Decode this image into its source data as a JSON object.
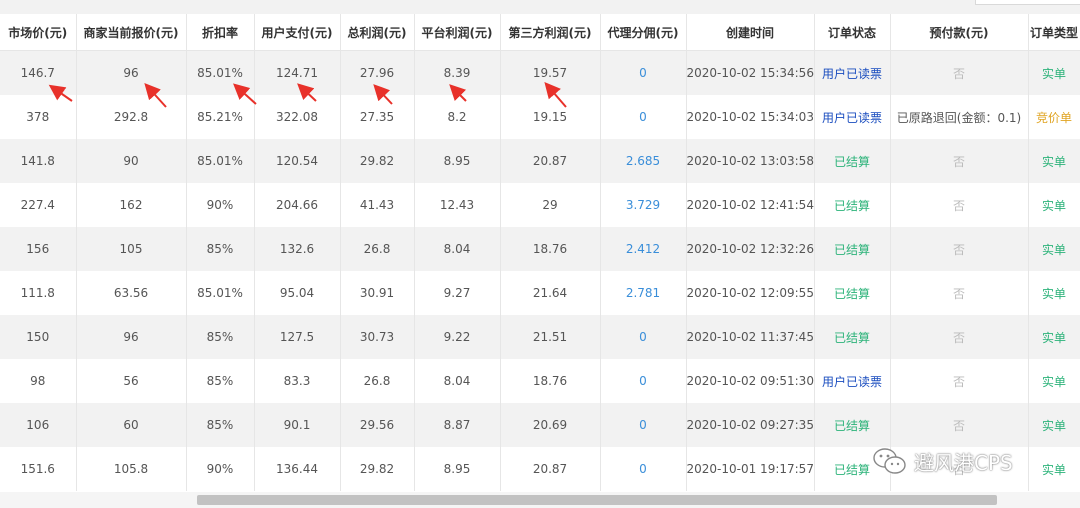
{
  "headers": [
    "市场价(元)",
    "商家当前报价(元)",
    "折扣率",
    "用户支付(元)",
    "总利润(元)",
    "平台利润(元)",
    "第三方利润(元)",
    "代理分佣(元)",
    "创建时间",
    "订单状态",
    "预付款(元)",
    "订单类型"
  ],
  "rows": [
    [
      "146.7",
      "96",
      "85.01%",
      "124.71",
      "27.96",
      "8.39",
      "19.57",
      "0",
      "2020-10-02 15:34:56",
      "用户已读票",
      "否",
      "实单"
    ],
    [
      "378",
      "292.8",
      "85.21%",
      "322.08",
      "27.35",
      "8.2",
      "19.15",
      "0",
      "2020-10-02 15:34:03",
      "用户已读票",
      "已原路退回(金额：0.1)",
      "竞价单"
    ],
    [
      "141.8",
      "90",
      "85.01%",
      "120.54",
      "29.82",
      "8.95",
      "20.87",
      "2.685",
      "2020-10-02 13:03:58",
      "已结算",
      "否",
      "实单"
    ],
    [
      "227.4",
      "162",
      "90%",
      "204.66",
      "41.43",
      "12.43",
      "29",
      "3.729",
      "2020-10-02 12:41:54",
      "已结算",
      "否",
      "实单"
    ],
    [
      "156",
      "105",
      "85%",
      "132.6",
      "26.8",
      "8.04",
      "18.76",
      "2.412",
      "2020-10-02 12:32:26",
      "已结算",
      "否",
      "实单"
    ],
    [
      "111.8",
      "63.56",
      "85.01%",
      "95.04",
      "30.91",
      "9.27",
      "21.64",
      "2.781",
      "2020-10-02 12:09:55",
      "已结算",
      "否",
      "实单"
    ],
    [
      "150",
      "96",
      "85%",
      "127.5",
      "30.73",
      "9.22",
      "21.51",
      "0",
      "2020-10-02 11:37:45",
      "已结算",
      "否",
      "实单"
    ],
    [
      "98",
      "56",
      "85%",
      "83.3",
      "26.8",
      "8.04",
      "18.76",
      "0",
      "2020-10-02 09:51:30",
      "用户已读票",
      "否",
      "实单"
    ],
    [
      "106",
      "60",
      "85%",
      "90.1",
      "29.56",
      "8.87",
      "20.69",
      "0",
      "2020-10-02 09:27:35",
      "已结算",
      "否",
      "实单"
    ],
    [
      "151.6",
      "105.8",
      "90%",
      "136.44",
      "29.82",
      "8.95",
      "20.87",
      "0",
      "2020-10-01 19:17:57",
      "已结算",
      "否",
      "实单"
    ]
  ],
  "watermark": {
    "text": "避风港CPS",
    "icon": "wechat-icon"
  },
  "colors": {
    "accent_blue": "#3a8ed9",
    "status_read": "#1a4dbf",
    "status_settled": "#2db37a",
    "type_bid": "#e0a422",
    "arrow_red": "#e8312a"
  }
}
